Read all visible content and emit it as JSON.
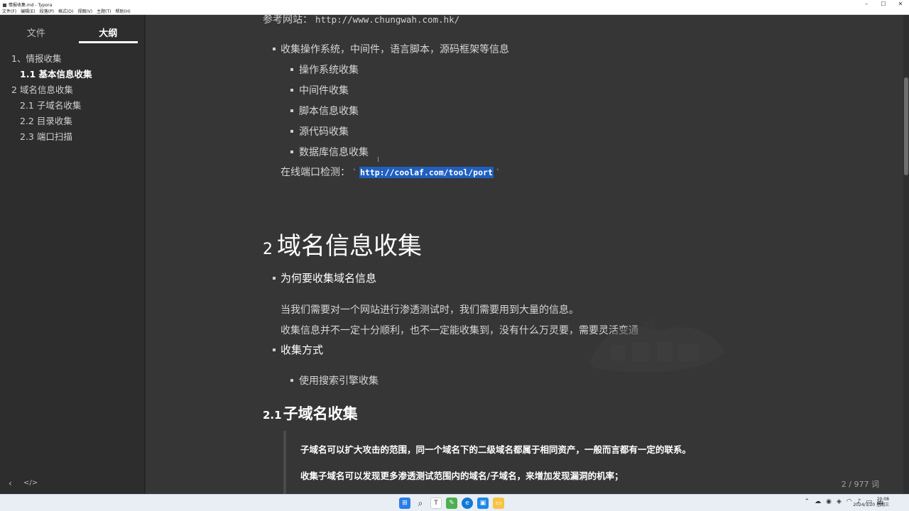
{
  "window": {
    "title": "情报收集.md - Typora",
    "controls": [
      "–",
      "☐",
      "✕"
    ]
  },
  "menu": [
    "文件(F)",
    "编辑(E)",
    "段落(P)",
    "格式(O)",
    "视图(V)",
    "主题(T)",
    "帮助(H)"
  ],
  "sidebar": {
    "tabs": [
      {
        "label": "文件",
        "active": false
      },
      {
        "label": "大纲",
        "active": true
      }
    ],
    "outline": [
      {
        "label": "1、情报收集",
        "level": 1,
        "active": false
      },
      {
        "label": "1.1 基本信息收集",
        "level": 2,
        "active": true
      },
      {
        "label": "2 域名信息收集",
        "level": 1,
        "active": false
      },
      {
        "label": "2.1 子域名收集",
        "level": 2,
        "active": false
      },
      {
        "label": "2.2 目录收集",
        "level": 2,
        "active": false
      },
      {
        "label": "2.3 端口扫描",
        "level": 2,
        "active": false
      }
    ],
    "footer": {
      "back_icon": "‹",
      "source_icon": "</>"
    }
  },
  "doc": {
    "ref_label": "参考网站：",
    "ref_url": "http://www.chungwah.com.hk/",
    "collect_item": "收集操作系统，中间件，语言脚本，源码框架等信息",
    "sub_items": [
      "操作系统收集",
      "中间件收集",
      "脚本信息收集",
      "源代码收集",
      "数据库信息收集"
    ],
    "online_label": "在线端口检测：",
    "online_tick": "`",
    "online_url": "http://coolaf.com/tool/port",
    "h1_num": "2",
    "h1_text": "域名信息收集",
    "why_heading": "为何要收集域名信息",
    "para1": "当我们需要对一个网站进行渗透测试时，我们需要用到大量的信息。",
    "para2": "收集信息并不一定十分顺利，也不一定能收集到，没有什么万灵要，需要灵活变通",
    "method_heading": "收集方式",
    "method_item": "使用搜索引擎收集",
    "h2_num": "2.1",
    "h2_text": "子域名收集",
    "quote1": "子域名可以扩大攻击的范围，同一个域名下的二级域名都属于相同资产，一般而言都有一定的联系。",
    "quote2": "收集子域名可以发现更多渗透测试范围内的域名/子域名，来增加发现漏洞的机率；"
  },
  "status": {
    "word_count": "2 / 977 词"
  },
  "taskbar": {
    "icons": [
      "windows-start-icon",
      "search-icon",
      "typora-icon",
      "file-explorer-icon",
      "edge-icon",
      "store-icon",
      "folder-icon"
    ],
    "clock_time": "20:08",
    "clock_date": "2024/3/20 星期三"
  }
}
